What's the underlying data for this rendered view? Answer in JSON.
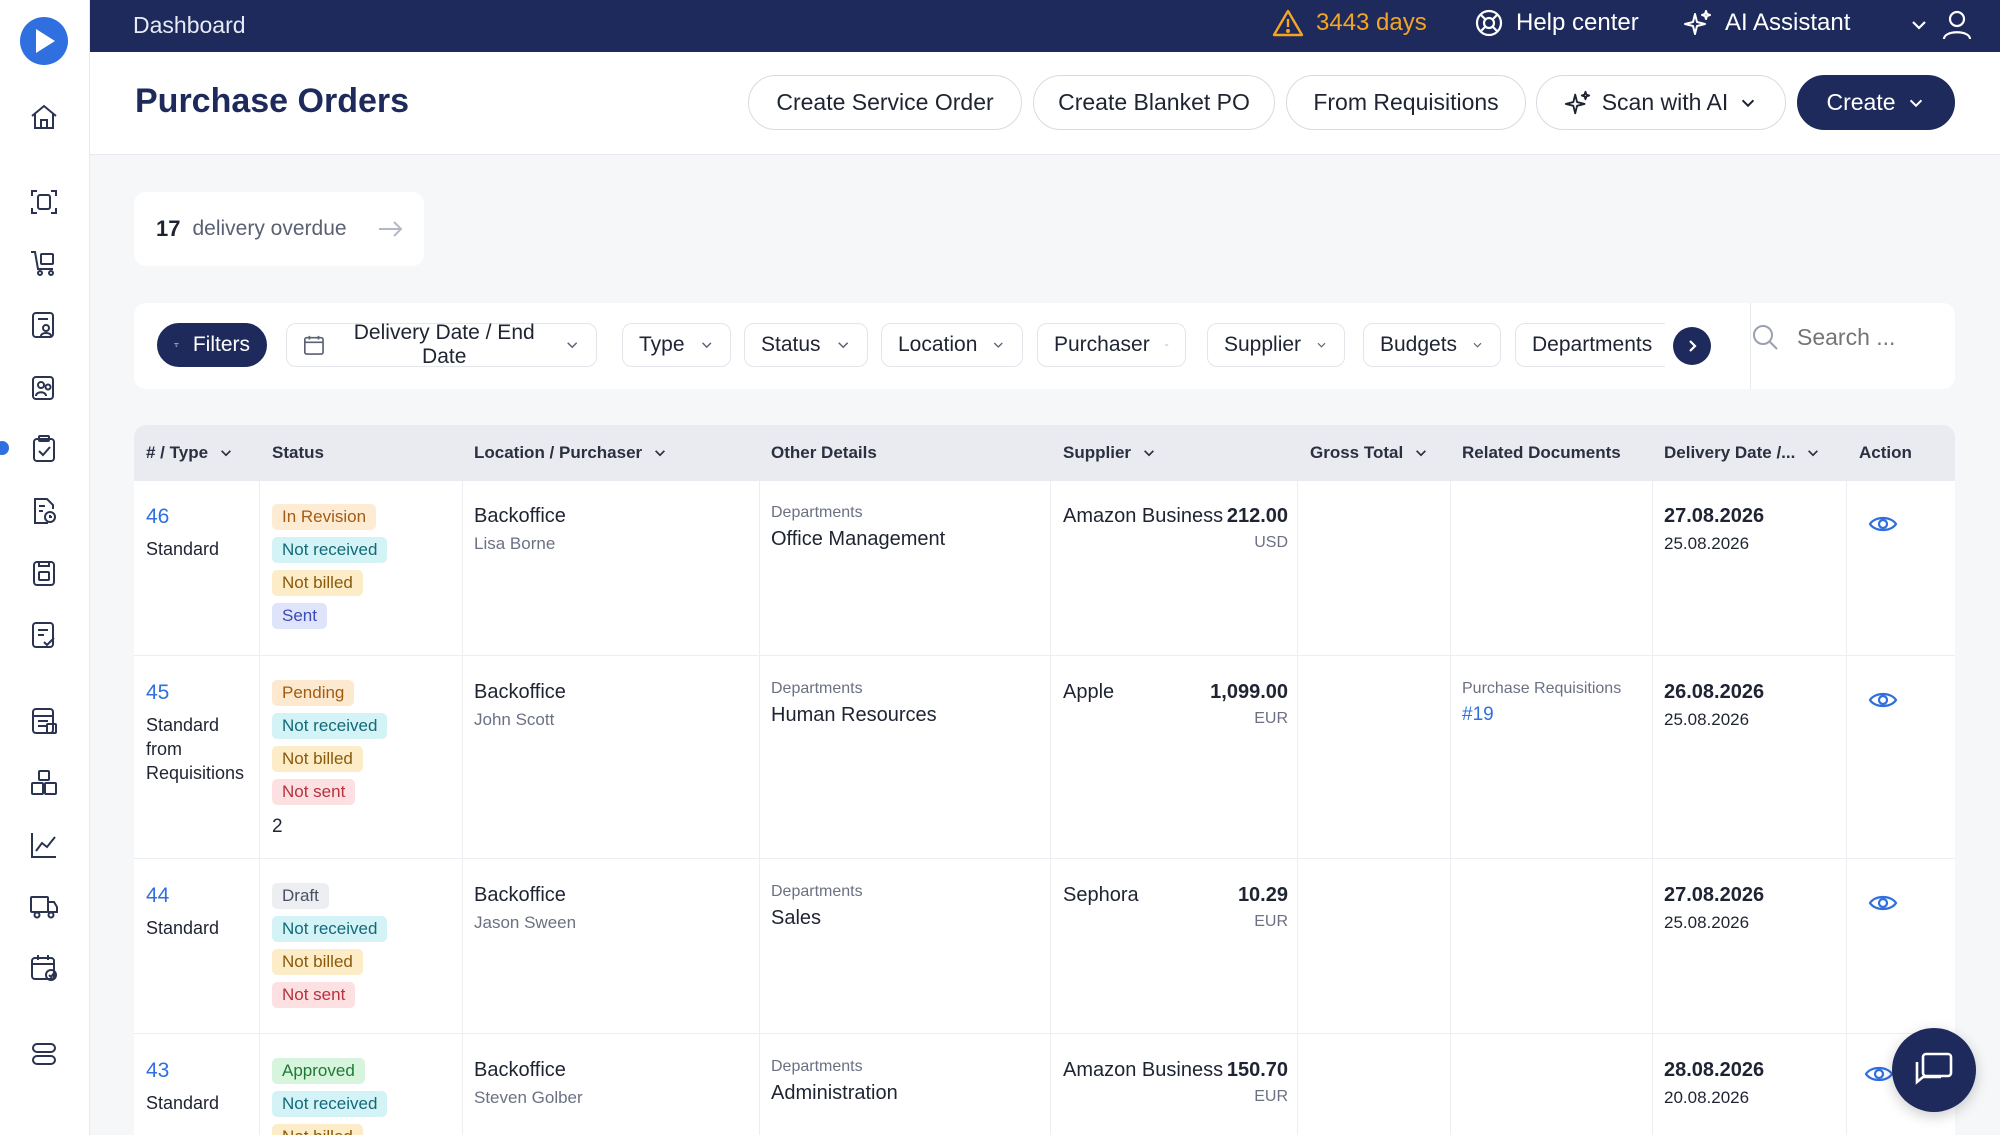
{
  "topbar": {
    "title": "Dashboard",
    "warning_text": "3443 days",
    "help_label": "Help center",
    "ai_label": "AI Assistant"
  },
  "header": {
    "title": "Purchase Orders",
    "buttons": {
      "service_order": "Create Service Order",
      "blanket_po": "Create Blanket PO",
      "from_requisitions": "From Requisitions",
      "scan_ai": "Scan with AI",
      "create": "Create"
    }
  },
  "overdue": {
    "count": "17",
    "label": "delivery overdue"
  },
  "filters": {
    "filters_label": "Filters",
    "delivery_date": "Delivery Date / End Date",
    "type": "Type",
    "status": "Status",
    "location": "Location",
    "purchaser": "Purchaser",
    "supplier": "Supplier",
    "budgets": "Budgets",
    "departments": "Departments",
    "search_placeholder": "Search ..."
  },
  "table": {
    "headers": {
      "num_type": "# / Type",
      "status": "Status",
      "location": "Location / Purchaser",
      "other": "Other Details",
      "supplier": "Supplier",
      "gross": "Gross Total",
      "related": "Related Documents",
      "delivery": "Delivery Date /...",
      "action": "Action"
    },
    "rows": [
      {
        "num": "46",
        "type": "Standard",
        "extra": "",
        "statuses": [
          "In Revision",
          "Not received",
          "Not billed",
          "Sent"
        ],
        "location": "Backoffice",
        "purchaser": "Lisa Borne",
        "other_label": "Departments",
        "other_value": "Office Management",
        "supplier": "Amazon Business",
        "amount": "212.00",
        "currency": "USD",
        "related_label": "",
        "related_link": "",
        "delivery": "27.08.2026",
        "delivery_sub": "25.08.2026"
      },
      {
        "num": "45",
        "type": "Standard from Requisitions",
        "extra": "2",
        "statuses": [
          "Pending",
          "Not received",
          "Not billed",
          "Not sent"
        ],
        "location": "Backoffice",
        "purchaser": "John Scott",
        "other_label": "Departments",
        "other_value": "Human Resources",
        "supplier": "Apple",
        "amount": "1,099.00",
        "currency": "EUR",
        "related_label": "Purchase Requisitions",
        "related_link": "#19",
        "delivery": "26.08.2026",
        "delivery_sub": "25.08.2026"
      },
      {
        "num": "44",
        "type": "Standard",
        "extra": "",
        "statuses": [
          "Draft",
          "Not received",
          "Not billed",
          "Not sent"
        ],
        "location": "Backoffice",
        "purchaser": "Jason Sween",
        "other_label": "Departments",
        "other_value": "Sales",
        "supplier": "Sephora",
        "amount": "10.29",
        "currency": "EUR",
        "related_label": "",
        "related_link": "",
        "delivery": "27.08.2026",
        "delivery_sub": "25.08.2026"
      },
      {
        "num": "43",
        "type": "Standard",
        "extra": "",
        "statuses": [
          "Approved",
          "Not received",
          "Not billed"
        ],
        "location": "Backoffice",
        "purchaser": "Steven Golber",
        "other_label": "Departments",
        "other_value": "Administration",
        "supplier": "Amazon Business",
        "amount": "150.70",
        "currency": "EUR",
        "related_label": "",
        "related_link": "",
        "delivery": "28.08.2026",
        "delivery_sub": "20.08.2026"
      }
    ]
  },
  "colors": {
    "navy": "#1d2a5b",
    "accent": "#2f6fe0",
    "warning": "#f5a524"
  }
}
